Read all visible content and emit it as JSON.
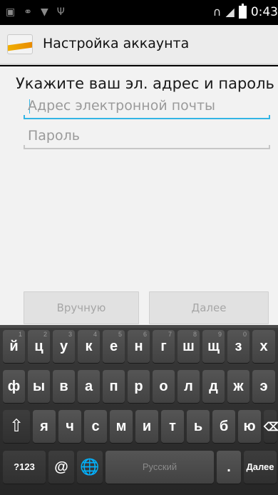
{
  "status_bar": {
    "time": "0:43",
    "left_icons": [
      "image-icon",
      "voicemail-icon",
      "wifi-icon",
      "usb-icon"
    ],
    "right_icons": [
      "headset-icon",
      "signal-icon",
      "battery-icon"
    ]
  },
  "action_bar": {
    "title": "Настройка аккаунта"
  },
  "form": {
    "heading": "Укажите ваш эл. адрес и пароль",
    "email_placeholder": "Адрес электронной почты",
    "password_placeholder": "Пароль",
    "manual_button": "Вручную",
    "next_button": "Далее"
  },
  "keyboard": {
    "row1": [
      {
        "label": "й",
        "hint": "1"
      },
      {
        "label": "ц",
        "hint": "2"
      },
      {
        "label": "у",
        "hint": "3"
      },
      {
        "label": "к",
        "hint": "4"
      },
      {
        "label": "е",
        "hint": "5"
      },
      {
        "label": "н",
        "hint": "6"
      },
      {
        "label": "г",
        "hint": "7"
      },
      {
        "label": "ш",
        "hint": "8"
      },
      {
        "label": "щ",
        "hint": "9"
      },
      {
        "label": "з",
        "hint": "0"
      },
      {
        "label": "х",
        "hint": ""
      }
    ],
    "row2": [
      "ф",
      "ы",
      "в",
      "а",
      "п",
      "р",
      "о",
      "л",
      "д",
      "ж",
      "э"
    ],
    "row3": [
      "я",
      "ч",
      "с",
      "м",
      "и",
      "т",
      "ь",
      "б",
      "ю"
    ],
    "symbols_key": "?123",
    "at_key": "@",
    "space_key": "Русский",
    "period_key": ".",
    "enter_key": "Далее"
  }
}
